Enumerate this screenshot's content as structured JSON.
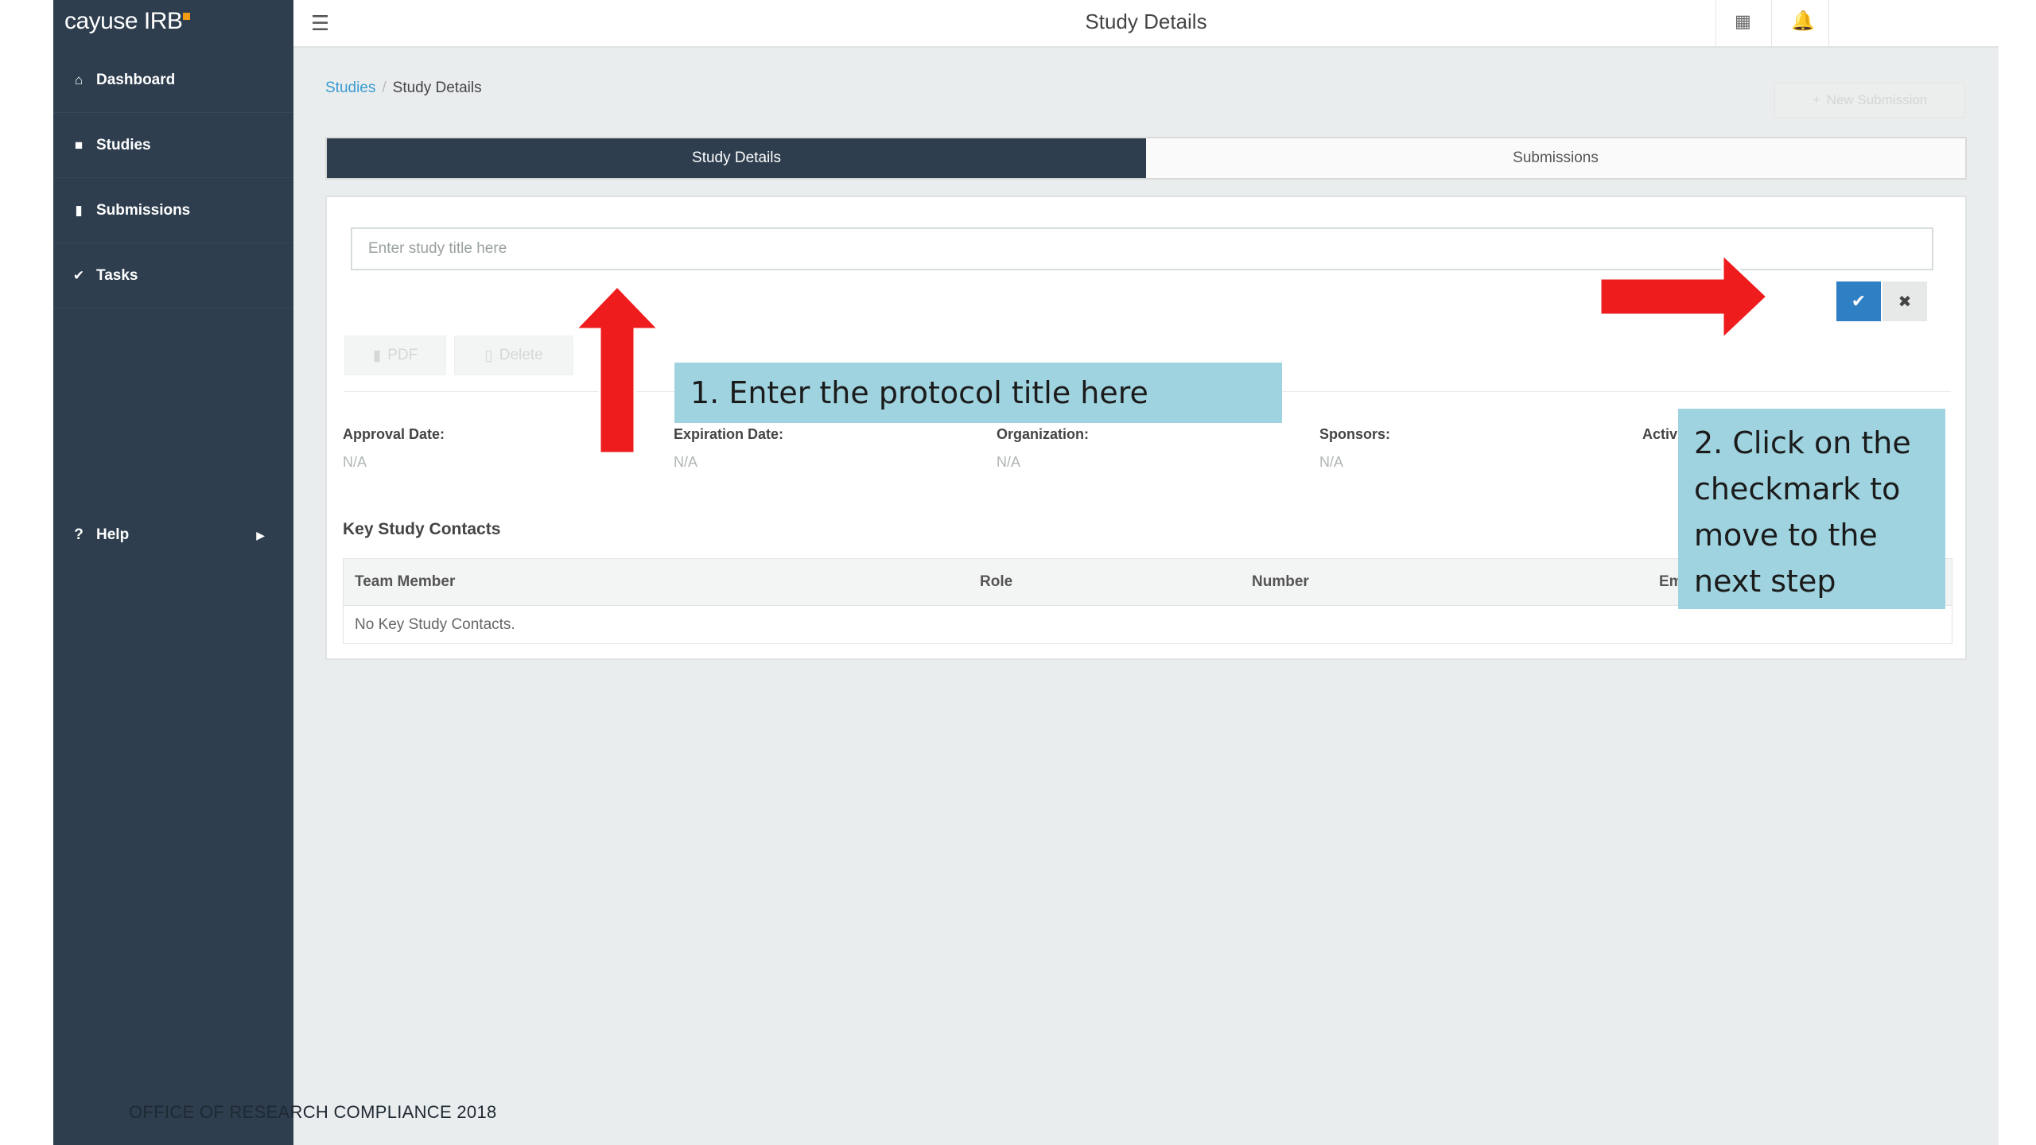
{
  "sidebar": {
    "brand": "cayuse IRB",
    "items": [
      {
        "label": "Dashboard",
        "icon": "home-icon"
      },
      {
        "label": "Studies",
        "icon": "folder-icon"
      },
      {
        "label": "Submissions",
        "icon": "document-icon"
      },
      {
        "label": "Tasks",
        "icon": "check-icon"
      }
    ],
    "help": {
      "label": "Help",
      "icon": "question-icon"
    }
  },
  "header": {
    "title": "Study Details"
  },
  "breadcrumb": {
    "link": "Studies",
    "separator": "/",
    "current": "Study Details"
  },
  "new_submission": {
    "label": "New Submission"
  },
  "tabs": [
    {
      "label": "Study Details",
      "active": true
    },
    {
      "label": "Submissions",
      "active": false
    }
  ],
  "form": {
    "title_placeholder": "Enter study title here",
    "title_value": ""
  },
  "actions": {
    "pdf_label": "PDF",
    "delete_label": "Delete"
  },
  "fields": [
    {
      "label": "Approval Date:",
      "value": "N/A"
    },
    {
      "label": "Expiration Date:",
      "value": "N/A"
    },
    {
      "label": "Organization:",
      "value": "N/A"
    },
    {
      "label": "Sponsors:",
      "value": "N/A"
    },
    {
      "label": "Activ",
      "value": ""
    }
  ],
  "contacts": {
    "title": "Key Study Contacts",
    "columns": [
      "Team Member",
      "Role",
      "Number",
      "Em"
    ],
    "empty_message": "No Key Study Contacts."
  },
  "annotations": {
    "step1": "1. Enter the protocol title here",
    "step2": "2. Click on the checkmark to move to the next step"
  },
  "footer": {
    "note": "OFFICE OF RESEARCH COMPLIANCE 2018"
  },
  "colors": {
    "sidebar": "#2e3e4e",
    "accent": "#2f7fc4",
    "link": "#3a9bd1",
    "annotation_arrow": "#ee1c1c",
    "annotation_callout": "#9fd3df",
    "brand_dot": "#f39c12"
  }
}
